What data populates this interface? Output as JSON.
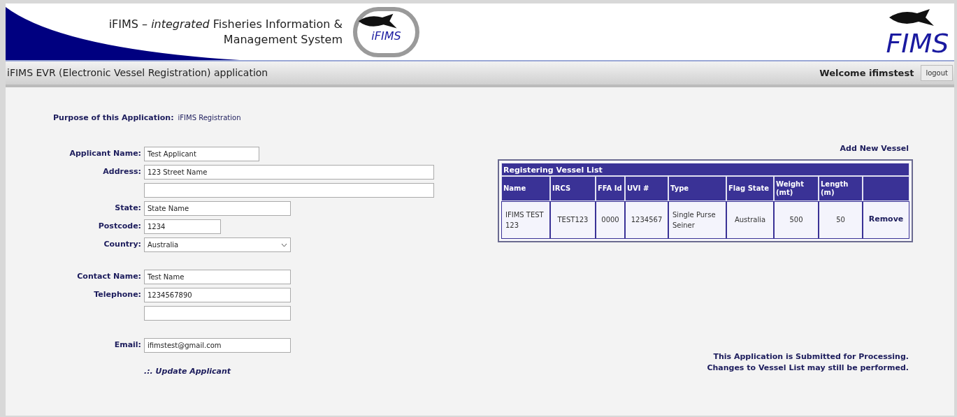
{
  "header": {
    "title": "iFIMS – *integrated* Fisheries Information & Management System",
    "logo_left_text": "iFIMS",
    "logo_right_text": "FIMS"
  },
  "app_bar": {
    "title": "iFIMS EVR (Electronic Vessel Registration) application",
    "welcome": "Welcome ifimstest",
    "logout": "logout"
  },
  "purpose": {
    "label": "Purpose of this Application:",
    "value": "iFIMS Registration"
  },
  "form_groups": [
    [
      {
        "kind": "text",
        "label": "Applicant Name:",
        "value": "Test Applicant"
      },
      {
        "kind": "text",
        "label": "Address:",
        "value": "123 Street Name"
      },
      {
        "kind": "text"
      },
      {
        "kind": "text",
        "label": "State:",
        "value": "State Name"
      },
      {
        "kind": "text",
        "label": "Postcode:",
        "value": "1234"
      },
      {
        "kind": "select",
        "label": "Country:",
        "value": "Australia"
      }
    ],
    [
      {
        "kind": "text",
        "label": "Contact Name:",
        "value": "Test Name"
      },
      {
        "kind": "text",
        "label": "Telephone:",
        "value": "1234567890"
      },
      {
        "kind": "text"
      }
    ],
    [
      {
        "kind": "text",
        "label": "Email:",
        "value": "ifimstest@gmail.com"
      }
    ]
  ],
  "update_link": ".:. Update Applicant",
  "add_vessel_link": "Add New Vessel",
  "vessel_table": {
    "title": "Registering Vessel List",
    "columns": [
      "Name",
      "IRCS",
      "FFA Id",
      "UVI #",
      "Type",
      "Flag State",
      "Weight (mt)",
      "Length (m)"
    ],
    "rows": [
      {
        "cells": [
          "IFIMS TEST 123",
          "TEST123",
          "0000",
          "1234567",
          "Single Purse Seiner",
          "Australia",
          "500",
          "50"
        ],
        "action": "Remove"
      }
    ]
  },
  "status_lines": [
    "This Application is Submitted for Processing.",
    "Changes to Vessel List may still be performed."
  ]
}
